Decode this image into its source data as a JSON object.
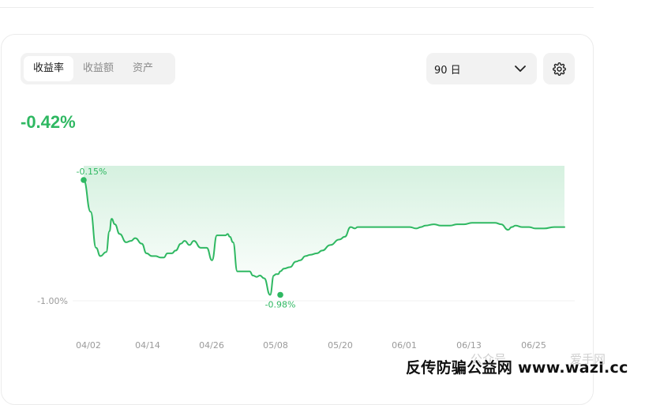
{
  "tabs": [
    {
      "label": "收益率",
      "active": true
    },
    {
      "label": "收益额",
      "active": false
    },
    {
      "label": "资产",
      "active": false
    }
  ],
  "period": {
    "value": "90 日"
  },
  "summary": {
    "value": "-0.42%"
  },
  "colors": {
    "accent": "#2fb862",
    "axis_text": "#9a9a9a"
  },
  "icons": {
    "dropdown": "chevron-down-icon",
    "settings": "gear-icon"
  },
  "chart_data": {
    "type": "area",
    "ylabel": "",
    "xlabel": "",
    "y_tick_labels": [
      "-1.00%"
    ],
    "x_tick_labels": [
      "04/02",
      "04/14",
      "04/26",
      "05/08",
      "05/20",
      "06/01",
      "06/13",
      "06/25"
    ],
    "annotations": {
      "max": {
        "label": "-0.15%",
        "x": 0,
        "y": -0.15
      },
      "min": {
        "label": "-0.98%",
        "x": 36.6,
        "y": -0.98
      }
    },
    "ylim": [
      -1.0,
      -0.15
    ],
    "xlim": [
      0,
      89.5
    ],
    "series": [
      {
        "x": [
          0,
          1.3,
          2.3,
          3.1,
          4.2,
          4.8,
          5.2,
          5.8,
          6.7,
          7.9,
          8.8,
          9.6,
          10.8,
          11.7,
          12.7,
          13.4,
          14.3,
          14.9,
          15.6,
          16.4,
          17.1,
          18.1,
          18.8,
          19.7,
          20.5,
          21.8,
          22.9,
          23.9,
          24.8,
          25.3,
          25.8,
          26.4,
          26.8,
          27.2,
          27.8,
          28.6,
          29.8,
          30.9,
          31.5,
          32.2,
          32.8,
          33.6,
          34.7,
          35.4,
          35.8,
          36.2,
          36.6,
          37.3,
          38.4,
          39.5,
          40.3,
          41.3,
          42.2,
          43.4,
          44.4,
          45.9,
          47.6,
          48.6,
          49.7,
          50.5,
          51,
          51.5,
          52.4,
          53.8,
          56,
          58.5,
          60.7,
          61.9,
          62.8,
          63.6,
          65.2,
          66.5,
          67.2,
          68.2,
          69.5,
          70.8,
          72.3,
          73.4,
          74.3,
          75.4,
          76.6,
          77.7,
          79,
          79.7,
          80.4,
          81.6,
          82.9,
          84.1,
          85.7,
          87.6,
          89.5
        ],
        "y": [
          -0.15,
          -0.38,
          -0.64,
          -0.7,
          -0.67,
          -0.52,
          -0.43,
          -0.47,
          -0.54,
          -0.6,
          -0.59,
          -0.57,
          -0.61,
          -0.68,
          -0.7,
          -0.7,
          -0.71,
          -0.71,
          -0.68,
          -0.68,
          -0.66,
          -0.61,
          -0.59,
          -0.62,
          -0.59,
          -0.64,
          -0.64,
          -0.73,
          -0.55,
          -0.55,
          -0.55,
          -0.55,
          -0.54,
          -0.56,
          -0.6,
          -0.81,
          -0.81,
          -0.81,
          -0.84,
          -0.85,
          -0.84,
          -0.86,
          -0.98,
          -0.84,
          -0.83,
          -0.83,
          -0.81,
          -0.79,
          -0.78,
          -0.74,
          -0.73,
          -0.7,
          -0.69,
          -0.68,
          -0.66,
          -0.62,
          -0.58,
          -0.56,
          -0.49,
          -0.5,
          -0.49,
          -0.49,
          -0.49,
          -0.49,
          -0.49,
          -0.49,
          -0.49,
          -0.5,
          -0.49,
          -0.48,
          -0.47,
          -0.48,
          -0.48,
          -0.48,
          -0.47,
          -0.47,
          -0.46,
          -0.46,
          -0.46,
          -0.46,
          -0.46,
          -0.47,
          -0.51,
          -0.49,
          -0.48,
          -0.49,
          -0.49,
          -0.5,
          -0.5,
          -0.49,
          -0.49
        ]
      }
    ]
  },
  "overlay": {
    "faint_left": "公众号",
    "faint_right": "爱手网",
    "watermark": "反传防骗公益网 www.wazi.cc"
  }
}
